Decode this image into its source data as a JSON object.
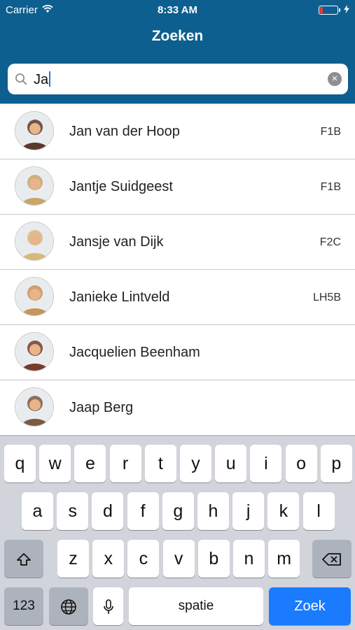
{
  "status": {
    "carrier": "Carrier",
    "time": "8:33 AM",
    "battery_level": 0.15
  },
  "header": {
    "title": "Zoeken"
  },
  "search": {
    "value": "Ja"
  },
  "contacts": [
    {
      "name": "Jan van der Hoop",
      "code": "F1B",
      "avatar_color": "#5a3a2a"
    },
    {
      "name": "Jantje Suidgeest",
      "code": "F1B",
      "avatar_color": "#c9a56a"
    },
    {
      "name": "Jansje van Dijk",
      "code": "F2C",
      "avatar_color": "#d6b97a"
    },
    {
      "name": "Janieke Lintveld",
      "code": "LH5B",
      "avatar_color": "#c79558"
    },
    {
      "name": "Jacquelien Beenham",
      "code": "",
      "avatar_color": "#7a3a2e"
    },
    {
      "name": "Jaap Berg",
      "code": "",
      "avatar_color": "#7b5a44"
    }
  ],
  "keyboard": {
    "row1": [
      "q",
      "w",
      "e",
      "r",
      "t",
      "y",
      "u",
      "i",
      "o",
      "p"
    ],
    "row2": [
      "a",
      "s",
      "d",
      "f",
      "g",
      "h",
      "j",
      "k",
      "l"
    ],
    "row3": [
      "z",
      "x",
      "c",
      "v",
      "b",
      "n",
      "m"
    ],
    "numbers_label": "123",
    "space_label": "spatie",
    "return_label": "Zoek",
    "icons": {
      "shift": "shift-icon",
      "delete": "delete-icon",
      "globe": "globe-icon",
      "mic": "microphone-icon"
    }
  },
  "colors": {
    "header": "#0d5f8f",
    "return_key": "#1a7bff"
  }
}
